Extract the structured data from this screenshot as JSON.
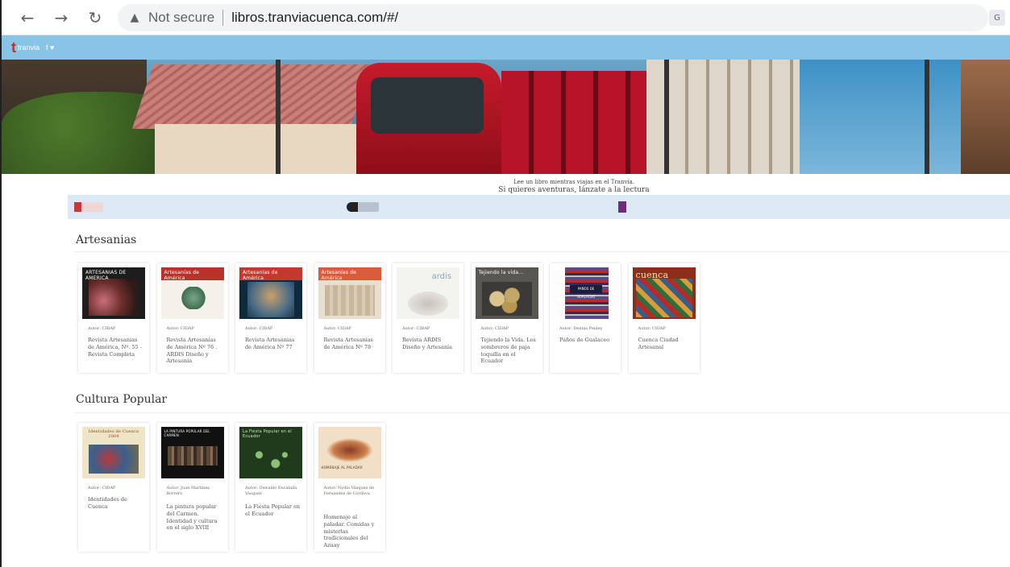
{
  "browser": {
    "security_label": "Not secure",
    "url": "libros.tranviacuenca.com/#/"
  },
  "site": {
    "logo_text": "tranvia",
    "social": "f  ♥"
  },
  "tagline": {
    "line1": "Lee un libro mientras viajas en el Tranvía.",
    "line2": "Si quieres aventuras, lánzate a la lectura"
  },
  "sections": [
    {
      "title": "Artesanias",
      "books": [
        {
          "author": "Autor: CIDAP",
          "title": "Revista Artesanias de América, Nº. 55 - Revista Completa",
          "cover_title": "ARTESANIAS DE AMERICA"
        },
        {
          "author": "Autor: CIDAP",
          "title": "Revista Artesanias de América Nº 76 . ARDIS Diseño y Artesanía",
          "cover_title": "Artesanías de América"
        },
        {
          "author": "Autor: CIDAP",
          "title": "Revista Artesanias de América Nº 77",
          "cover_title": "Artesanías de América"
        },
        {
          "author": "Autor: CIDAP",
          "title": "Revista Artesanias de América Nº 78",
          "cover_title": "Artesanías de América"
        },
        {
          "author": "Autor: CIDAP",
          "title": "Revista ARDIS Diseño y Artesanía",
          "cover_title": "ardis"
        },
        {
          "author": "Autor: CIDAP",
          "title": "Tejiendo la Vida. Los sombreros de paja toquilla en el Ecuador",
          "cover_title": "Tejiendo la vida..."
        },
        {
          "author": "Autor: Dennis Penley",
          "title": "Paños de Gualaceo",
          "cover_title": "PAÑOS DE GUALACEO"
        },
        {
          "author": "Autor: CIDAP",
          "title": "Cuenca Ciudad Artesanal",
          "cover_title": "cuenca"
        }
      ]
    },
    {
      "title": "Cultura Popular",
      "books": [
        {
          "author": "Autor: CIDAP",
          "title": "Identidades de Cuenca",
          "cover_title": "Identidades de Cuenca 2004"
        },
        {
          "author": "Autor: Juan Martínez Borrero",
          "title": "La pintura popular del Carmen. Identidad y cultura en el siglo XVIII",
          "cover_title": "LA PINTURA POPULAR DEL CARMEN"
        },
        {
          "author": "Autor: Oswaldo Encalada Vásquez",
          "title": "La Fiesta Popular en el Ecuador",
          "cover_title": "La Fiesta Popular en el Ecuador"
        },
        {
          "author": "Autor: Nydia Vásquez de Fernández de Córdova",
          "title": "Homenaje al paladar. Comidas y misterlas tradicionales del Azuay",
          "cover_title": "HOMENAJE AL PALADAR"
        }
      ]
    }
  ]
}
